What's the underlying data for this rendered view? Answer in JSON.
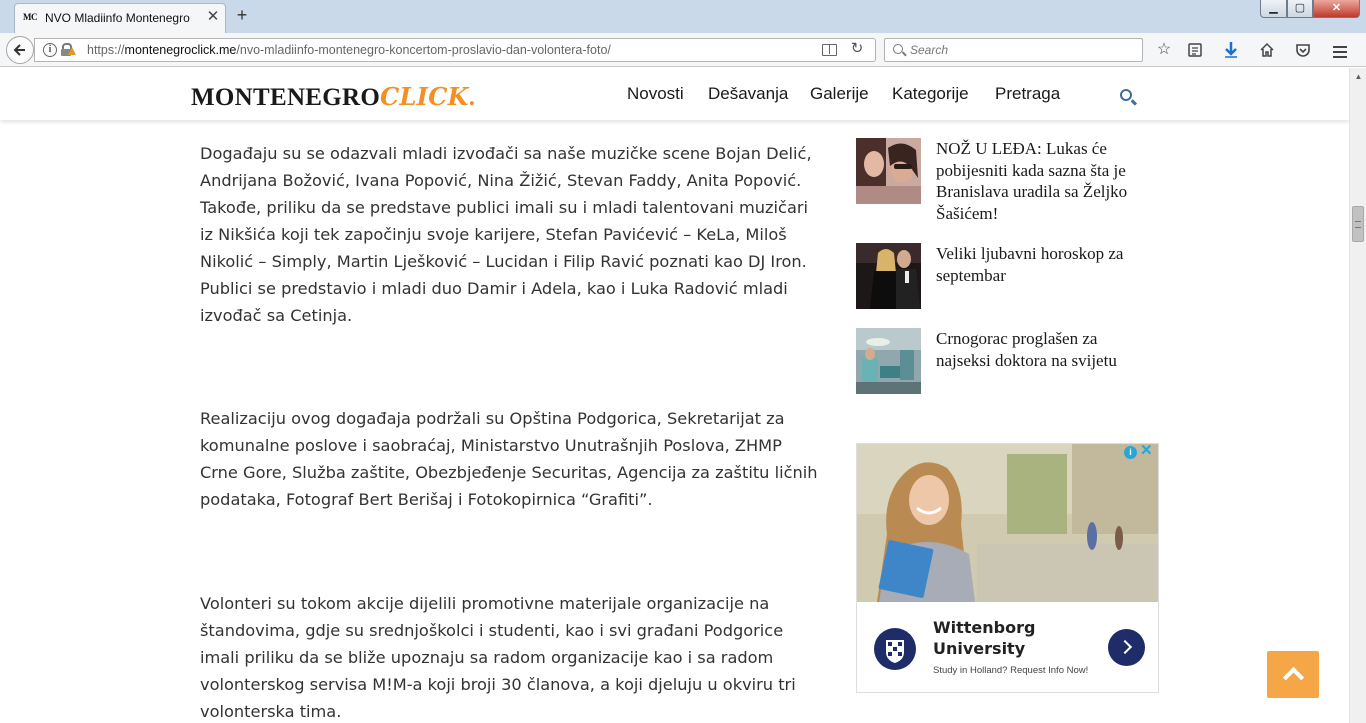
{
  "browser": {
    "tab_title": "NVO Mladiinfo Montenegro",
    "tab_favicon": "MC",
    "tab_close": "✕",
    "new_tab": "+",
    "url_https": "https://",
    "url_domain": "montenegroclick.me",
    "url_path": "/nvo-mladiinfo-montenegro-koncertom-proslavio-dan-volontera-foto/",
    "search_placeholder": "Search",
    "window_controls": {
      "minimize": "▁",
      "maximize": "▢",
      "close": "✕"
    }
  },
  "site": {
    "logo_main": "MONTENEGRO",
    "logo_accent": "CLICK",
    "logo_dot": ".",
    "nav": [
      {
        "label": "Novosti"
      },
      {
        "label": "Dešavanja"
      },
      {
        "label": "Galerije"
      },
      {
        "label": "Kategorije"
      },
      {
        "label": "Pretraga"
      }
    ]
  },
  "article": {
    "paragraphs": [
      "Događaju su se odazvali mladi izvođači sa naše muzičke scene Bojan Delić, Andrijana Božović, Ivana Popović, Nina Žižić, Stevan Faddy, Anita Popović. Takođe, priliku da se predstave publici imali su i mladi talentovani muzičari iz Nikšića koji tek započinju svoje karijere, Stefan Pavićević – KeLa, Miloš Nikolić – Simply, Martin Lješković – Lucidan i Filip Ravić poznati kao DJ Iron. Publici se predstavio i mladi duo Damir i Adela, kao i Luka Radović mladi izvođač sa Cetinja.",
      "Realizaciju ovog događaja podržali su Opština Podgorica, Sekretarijat za komunalne poslove i saobraćaj, Ministarstvo Unutrašnjih Poslova, ZHMP Crne Gore, Služba zaštite, Obezbjeđenje Securitas, Agencija za zaštitu ličnih podataka, Fotograf Bert Berišaj i Fotokopirnica “Grafiti”.",
      "Volonteri su tokom akcije dijelili promotivne materijale organizacije na štandovima, gdje su srednjoškolci i studenti, kao i svi građani Podgorice imali priliku da se bliže upoznaju sa radom organizacije kao i sa radom volonterskog servisa M!M-a koji broji 30 članova, a koji djeluju u okviru tri volonterska tima."
    ]
  },
  "sidebar": {
    "related": [
      {
        "title": "NOŽ U LEĐA: Lukas će pobijesniti kada sazna šta je Branislava uradila sa Željko Šašićem!"
      },
      {
        "title": "Veliki ljubavni horoskop za septembar"
      },
      {
        "title": "Crnogorac proglašen za najseksi doktora na svijetu"
      }
    ],
    "ad": {
      "name": "Wittenborg University",
      "tagline": "Study in Holland? Request Info Now!",
      "info_glyph": "i",
      "close_glyph": "✕"
    }
  },
  "colors": {
    "accent": "#f29025",
    "back_to_top": "#f5a646",
    "ad_brand": "#1e2c6a",
    "search_icon": "#3d6f96"
  }
}
